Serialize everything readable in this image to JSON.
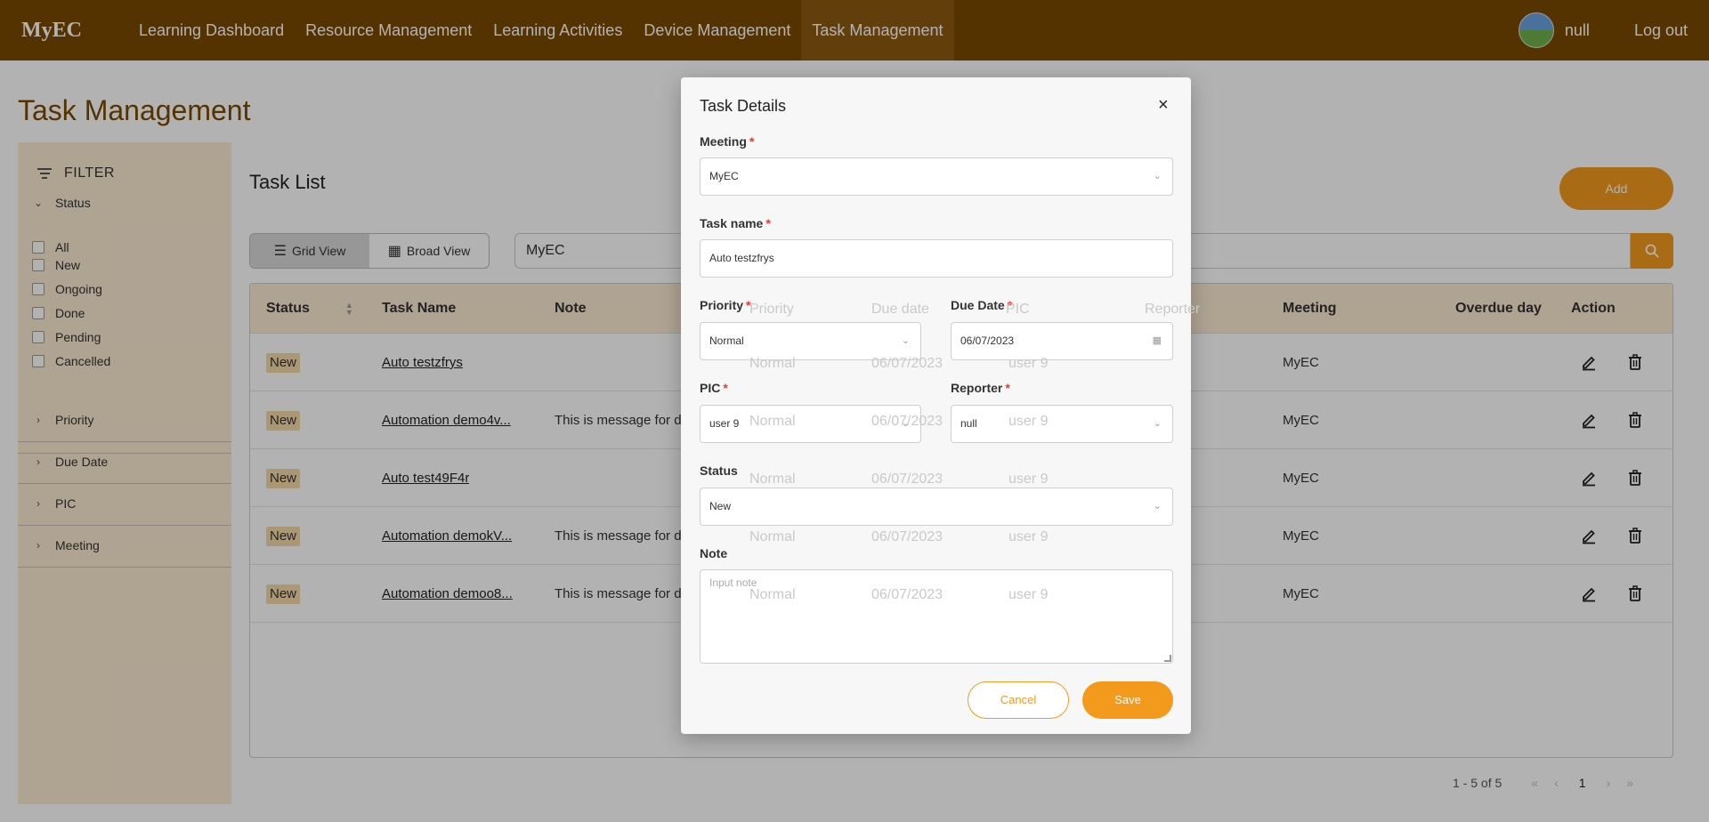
{
  "app": {
    "brand": "MyEC",
    "nav": [
      "Learning Dashboard",
      "Resource Management",
      "Learning Activities",
      "Device Management",
      "Task Management"
    ],
    "active_nav": "Task Management",
    "user": "null",
    "logout": "Log out"
  },
  "page": {
    "title": "Task Management"
  },
  "filter": {
    "title": "FILTER",
    "status_label": "Status",
    "status_options": [
      "All",
      "New",
      "Ongoing",
      "Done",
      "Pending",
      "Cancelled"
    ],
    "sections": [
      "Priority",
      "Due Date",
      "PIC",
      "Meeting"
    ]
  },
  "task_list": {
    "title": "Task List",
    "add_label": "Add",
    "grid_view": "Grid View",
    "broad_view": "Broad View",
    "search_value": "MyEC",
    "columns": [
      "Status",
      "Task Name",
      "Note",
      "Priority",
      "Due date",
      "PIC",
      "Reporter",
      "Meeting",
      "Overdue day",
      "Action"
    ],
    "rows": [
      {
        "status": "New",
        "name": "Auto testzfrys",
        "note": "",
        "priority": "Normal",
        "due": "06/07/2023",
        "pic": "user 9",
        "meeting": "MyEC"
      },
      {
        "status": "New",
        "name": "Automation demo4v...",
        "note": "This is message for dem...",
        "priority": "Normal",
        "due": "06/07/2023",
        "pic": "user 9",
        "meeting": "MyEC"
      },
      {
        "status": "New",
        "name": "Auto test49F4r",
        "note": "",
        "priority": "Normal",
        "due": "06/07/2023",
        "pic": "user 9",
        "meeting": "MyEC"
      },
      {
        "status": "New",
        "name": "Automation demokV...",
        "note": "This is message for dem...",
        "priority": "Normal",
        "due": "06/07/2023",
        "pic": "user 9",
        "meeting": "MyEC"
      },
      {
        "status": "New",
        "name": "Automation demoo8...",
        "note": "This is message for dem...",
        "priority": "Normal",
        "due": "06/07/2023",
        "pic": "user 9",
        "meeting": "MyEC"
      }
    ],
    "pagination": {
      "range": "1 - 5 of 5",
      "current_page": "1"
    }
  },
  "modal": {
    "title": "Task Details",
    "close": "×",
    "meeting": {
      "label": "Meeting",
      "value": "MyEC"
    },
    "task_name": {
      "label": "Task name",
      "value": "Auto testzfrys"
    },
    "priority": {
      "label": "Priority",
      "value": "Normal"
    },
    "due_date": {
      "label": "Due Date",
      "value": "06/07/2023"
    },
    "pic": {
      "label": "PIC",
      "value": "user 9"
    },
    "reporter": {
      "label": "Reporter",
      "value": "null"
    },
    "status": {
      "label": "Status",
      "value": "New"
    },
    "note": {
      "label": "Note",
      "placeholder": "Input note"
    },
    "cancel": "Cancel",
    "save": "Save",
    "required_mark": "*"
  },
  "colors": {
    "nav_bg": "#7a4a00",
    "accent": "#f39a1d",
    "sidebar_bg": "#fbead2",
    "badge_bg": "#f6d8a8"
  }
}
